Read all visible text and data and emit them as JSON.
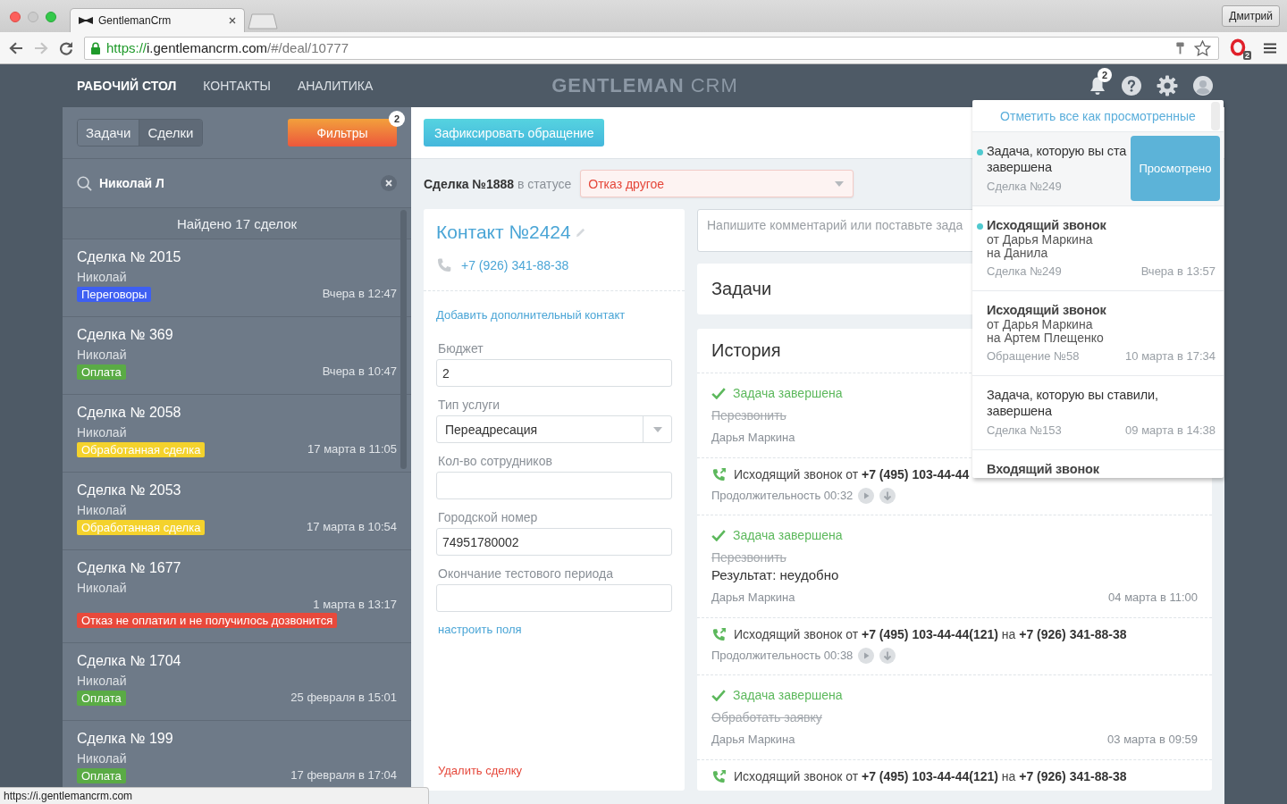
{
  "browser": {
    "tab_title": "GentlemanCrm",
    "nav_buttons": [
      {
        "kind": "back",
        "disabled": false
      },
      {
        "kind": "forward",
        "disabled": true
      },
      {
        "kind": "reload",
        "disabled": false
      }
    ],
    "url": {
      "scheme": "https://",
      "host": "i.gentlemancrm.com",
      "path": "/#/deal/10777"
    },
    "profile": "Дмитрий",
    "extension_badge": "2",
    "status_url": "https://i.gentlemancrm.com"
  },
  "nav": {
    "items": [
      {
        "label": "РАБОЧИЙ СТОЛ",
        "selected": true
      },
      {
        "label": "КОНТАКТЫ",
        "selected": false
      },
      {
        "label": "АНАЛИТИКА",
        "selected": false
      }
    ],
    "logo": "**GENTLEMAN** CRM",
    "notification_count": "2"
  },
  "sidebar": {
    "tabs": [
      {
        "label": "Задачи",
        "selected": false
      },
      {
        "label": "Сделки",
        "selected": true
      }
    ],
    "filter_button": "Фильтры",
    "filter_count": "2",
    "search": {
      "value": "Николай Л"
    },
    "found": "Найдено 17 сделок",
    "deals": [
      {
        "title": "Сделка № 2015",
        "contact": "Николай",
        "tag": {
          "label": "Переговоры",
          "color": "#3e5ff2"
        },
        "time": "Вчера в 12:47"
      },
      {
        "title": "Сделка № 369",
        "contact": "Николай",
        "tag": {
          "label": "Оплата",
          "color": "#5aab45"
        },
        "time": "Вчера в 10:47"
      },
      {
        "title": "Сделка № 2058",
        "contact": "Николай",
        "tag": {
          "label": "Обработанная сделка",
          "color": "#f4d22c"
        },
        "time": "17 марта в 11:05"
      },
      {
        "title": "Сделка № 2053",
        "contact": "Николай",
        "tag": {
          "label": "Обработанная сделка",
          "color": "#f4d22c"
        },
        "time": "17 марта в 10:54"
      },
      {
        "title": "Сделка № 1677",
        "contact": "Николай",
        "tag": {
          "label": "Отказ не оплатил и не получилось дозвонится",
          "color": "#e8493b"
        },
        "time": "1 марта в 13:17"
      },
      {
        "title": "Сделка № 1704",
        "contact": "Николай",
        "tag": {
          "label": "Оплата",
          "color": "#5aab45"
        },
        "time": "25 февраля в 15:01"
      },
      {
        "title": "Сделка № 199",
        "contact": "Николай",
        "tag": {
          "label": "Оплата",
          "color": "#5aab45"
        },
        "time": "17 февраля в 17:04"
      }
    ]
  },
  "toolbar": {
    "action_button": "Зафиксировать обращение"
  },
  "deal": {
    "heading": "**Сделка №1888** в статусе",
    "status": "Отказ другое"
  },
  "contact": {
    "title": "Контакт №2424",
    "phone": "+7 (926) 341-88-38",
    "add_contact": "Добавить дополнительный контакт",
    "fields": [
      {
        "kind": "text",
        "label": "Бюджет",
        "value": "2"
      },
      {
        "kind": "select",
        "label": "Тип услуги",
        "value": "Переадресация"
      },
      {
        "kind": "text",
        "label": "Кол-во сотрудников"
      },
      {
        "kind": "text",
        "label": "Городской номер",
        "value": "74951780002"
      },
      {
        "kind": "text",
        "label": "Окончание тестового периода"
      }
    ],
    "configure_link": "настроить поля",
    "delete_link": "Удалить сделку"
  },
  "comment": {
    "placeholder": "Напишите комментарий или поставьте зада"
  },
  "tasks": {
    "title": "Задачи"
  },
  "history": {
    "title": "История",
    "entries": [
      {
        "kind": "task",
        "status": "Задача завершена",
        "task": "Перезвонить",
        "author": "Дарья Маркина"
      },
      {
        "kind": "call",
        "text": "Исходящий звонок от **+7 (495) 103-44-44**",
        "duration": "Продолжительность 00:32"
      },
      {
        "kind": "task",
        "status": "Задача завершена",
        "task": "Перезвонить",
        "result": "Результат: неудобно",
        "author": "Дарья Маркина",
        "time": "04 марта в 11:00"
      },
      {
        "kind": "call",
        "text": "Исходящий звонок от **+7 (495) 103-44-44(121)** на **+7 (926) 341-88-38**",
        "duration": "Продолжительность 00:38"
      },
      {
        "kind": "task",
        "status": "Задача завершена",
        "task": "Обработать заявку",
        "author": "Дарья Маркина",
        "time": "03 марта в 09:59"
      },
      {
        "kind": "call",
        "text": "Исходящий звонок от **+7 (495) 103-44-44(121)** на **+7 (926) 341-88-38**"
      }
    ]
  },
  "notifications": {
    "mark_all": "Отметить все как просмотренные",
    "items": [
      {
        "kind": "task",
        "unread": true,
        "hovered": true,
        "title_lines": [
          "Задача, которую вы ста",
          "завершена"
        ],
        "ref": "Сделка №249",
        "action": "Просмотрено"
      },
      {
        "kind": "call",
        "unread": true,
        "hovered": false,
        "title_lines": [
          "Исходящий звонок"
        ],
        "lines": [
          "от Дарья Маркина",
          "на Данила"
        ],
        "ref": "Сделка №249",
        "time": "Вчера в 13:57"
      },
      {
        "kind": "call",
        "unread": false,
        "hovered": false,
        "title_lines": [
          "Исходящий звонок"
        ],
        "lines": [
          "от Дарья Маркина",
          "на Артем Плещенко"
        ],
        "ref": "Обращение №58",
        "time": "10 марта в 17:34"
      },
      {
        "kind": "task",
        "unread": false,
        "hovered": false,
        "title_lines": [
          "Задача, которую вы ставили,",
          "завершена"
        ],
        "ref": "Сделка №153",
        "time": "09 марта в 14:38"
      },
      {
        "kind": "call",
        "unread": false,
        "hovered": false,
        "title_lines": [
          "Входящий звонок"
        ]
      }
    ]
  }
}
